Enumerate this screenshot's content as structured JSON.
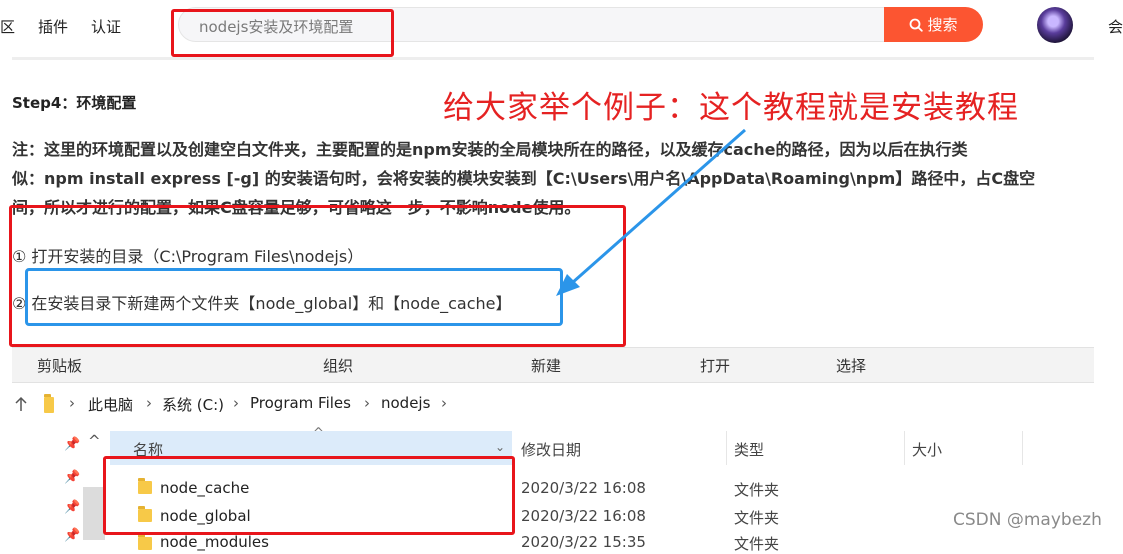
{
  "nav": {
    "items": [
      "区",
      "插件",
      "认证"
    ],
    "right_label": "会"
  },
  "search": {
    "query": "nodejs安装及环境配置",
    "button_label": "搜索",
    "button_icon": "search-icon"
  },
  "annotation": "给大家举个例子：这个教程就是安装教程",
  "article": {
    "step_title": "Step4：环境配置",
    "note_lines": [
      "注：这里的环境配置以及创建空白文件夹，主要配置的是npm安装的全局模块所在的路径，以及缓存cache的路径，因为以后在执行类",
      "似：npm install express [-g] 的安装语句时，会将安装的模块安装到【C:\\Users\\用户名\\AppData\\Roaming\\npm】路径中，占C盘空",
      "间，所以才进行的配置，如果C盘容量足够，可省略这一步，不影响node使用。"
    ],
    "item1": "① 打开安装的目录（C:\\Program Files\\nodejs）",
    "item2": "② 在安装目录下新建两个文件夹【node_global】和【node_cache】"
  },
  "explorer": {
    "ribbon": [
      "剪贴板",
      "组织",
      "新建",
      "打开",
      "选择"
    ],
    "breadcrumb": [
      "此电脑",
      "系统 (C:)",
      "Program Files",
      "nodejs"
    ],
    "columns": {
      "name": "名称",
      "modified": "修改日期",
      "type": "类型",
      "size": "大小"
    },
    "rows": [
      {
        "name": "node_cache",
        "modified": "2020/3/22 16:08",
        "type": "文件夹"
      },
      {
        "name": "node_global",
        "modified": "2020/3/22 16:08",
        "type": "文件夹"
      },
      {
        "name": "node_modules",
        "modified": "2020/3/22 15:35",
        "type": "文件夹"
      }
    ]
  },
  "watermark": "CSDN @maybezh",
  "colors": {
    "accent": "#fc5531",
    "annotation_red": "#e52222",
    "highlight_blue": "#2b95e9",
    "box_red": "#e8151b"
  }
}
